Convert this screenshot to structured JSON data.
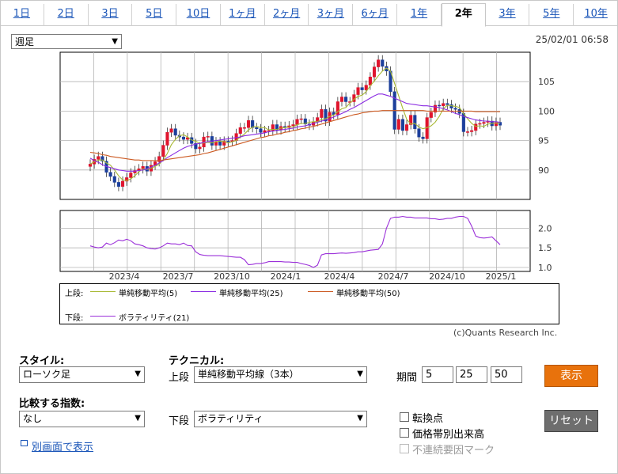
{
  "tabs": [
    "1日",
    "2日",
    "3日",
    "5日",
    "10日",
    "1ヶ月",
    "2ヶ月",
    "3ヶ月",
    "6ヶ月",
    "1年",
    "2年",
    "3年",
    "5年",
    "10年"
  ],
  "active_tab": "2年",
  "period_select": "週足",
  "timestamp": "25/02/01 06:58",
  "legend": {
    "upper_label": "上段:",
    "lower_label": "下段:",
    "items": [
      {
        "name": "単純移動平均(5)",
        "color": "#a8b833"
      },
      {
        "name": "単純移動平均(25)",
        "color": "#8a2be2"
      },
      {
        "name": "単純移動平均(50)",
        "color": "#cc5a22"
      }
    ],
    "lower_item": {
      "name": "ボラティリティ(21)",
      "color": "#9b30d9"
    }
  },
  "copyright": "(c)Quants Research Inc.",
  "controls": {
    "style_label": "スタイル:",
    "style_value": "ローソク足",
    "technical_label": "テクニカル:",
    "upper_label": "上段",
    "upper_value": "単純移動平均線（3本）",
    "period_label": "期間",
    "periods": [
      "5",
      "25",
      "50"
    ],
    "show_button": "表示",
    "compare_label": "比較する指数:",
    "compare_value": "なし",
    "lower_label": "下段",
    "lower_value": "ボラティリティ",
    "reset_button": "リセット",
    "checkboxes": [
      "転換点",
      "価格帯別出来高",
      "不連続要因マーク"
    ],
    "popup_link": "別画面で表示"
  },
  "chart_data": [
    {
      "type": "candlestick",
      "title": "",
      "y_ticks": [
        90,
        95,
        100,
        105
      ],
      "ylim": [
        85,
        110
      ],
      "x_ticks": [
        "2023/4",
        "2023/7",
        "2023/10",
        "2024/1",
        "2024/4",
        "2024/7",
        "2024/10",
        "2025/1"
      ],
      "close": [
        91.0,
        91.8,
        92.3,
        91.5,
        89.6,
        88.9,
        87.9,
        87.2,
        88.1,
        88.7,
        89.5,
        89.9,
        90.2,
        90.6,
        89.8,
        90.8,
        91.4,
        92.3,
        94.2,
        96.4,
        97.0,
        95.9,
        95.6,
        95.2,
        95.5,
        94.5,
        93.6,
        93.9,
        95.6,
        95.7,
        94.2,
        94.8,
        94.2,
        94.9,
        94.8,
        95.0,
        96.2,
        97.2,
        97.2,
        98.4,
        97.2,
        97.0,
        96.4,
        96.7,
        96.7,
        97.7,
        96.8,
        97.4,
        97.2,
        97.5,
        97.7,
        98.6,
        98.7,
        97.8,
        97.6,
        98.2,
        98.9,
        100.3,
        98.3,
        99.8,
        99.4,
        101.6,
        102.4,
        101.6,
        101.6,
        102.8,
        104.0,
        103.6,
        104.4,
        105.8,
        107.5,
        108.7,
        107.6,
        106.8,
        103.3,
        96.9,
        98.6,
        96.7,
        97.7,
        99.3,
        97.0,
        95.6,
        95.3,
        98.9,
        99.8,
        101.0,
        100.9,
        101.3,
        101.1,
        100.5,
        100.3,
        99.6,
        96.5,
        96.5,
        96.7,
        97.8,
        97.9,
        98.1,
        98.3,
        97.5,
        98.1,
        97.6
      ],
      "series": [
        {
          "name": "単純移動平均(5)",
          "values": [
            91.0,
            91.4,
            91.7,
            91.7,
            91.2,
            90.8,
            90.0,
            89.0,
            88.3,
            88.2,
            88.5,
            89.0,
            89.7,
            90.2,
            90.1,
            90.3,
            90.6,
            91.0,
            91.7,
            92.8,
            94.3,
            95.2,
            95.8,
            96.0,
            95.6,
            95.1,
            94.9,
            94.5,
            94.6,
            94.7,
            94.6,
            94.8,
            94.9,
            94.8,
            94.6,
            94.8,
            95.0,
            95.6,
            96.1,
            96.8,
            97.3,
            97.4,
            97.2,
            97.2,
            96.8,
            96.9,
            96.9,
            97.1,
            97.2,
            97.3,
            97.3,
            97.7,
            97.9,
            97.9,
            98.1,
            98.2,
            98.2,
            98.6,
            98.7,
            99.1,
            99.3,
            99.9,
            100.4,
            100.6,
            101.4,
            102.0,
            102.5,
            102.7,
            103.3,
            104.3,
            105.1,
            106.0,
            106.8,
            107.3,
            106.8,
            104.7,
            102.6,
            100.5,
            98.6,
            97.8,
            97.9,
            97.3,
            97.0,
            97.2,
            97.5,
            98.1,
            99.1,
            100.4,
            101.0,
            100.9,
            100.8,
            100.6,
            99.6,
            98.7,
            97.9,
            97.4,
            97.5,
            97.4,
            97.8,
            97.9,
            98.0,
            97.9
          ]
        },
        {
          "name": "単純移動平均(25)",
          "values": [
            92.0,
            91.6,
            91.3,
            90.9,
            90.6,
            90.4,
            90.2,
            90.0,
            89.9,
            89.8,
            89.8,
            89.8,
            89.9,
            90.0,
            90.2,
            90.5,
            90.8,
            91.2,
            91.6,
            92.1,
            92.5,
            92.9,
            93.3,
            93.7,
            94.0,
            94.2,
            94.4,
            94.5,
            94.7,
            94.8,
            94.9,
            95.0,
            95.1,
            95.2,
            95.3,
            95.4,
            95.5,
            95.6,
            95.8,
            95.9,
            96.0,
            96.1,
            96.2,
            96.3,
            96.5,
            96.6,
            96.7,
            96.8,
            96.9,
            97.0,
            97.1,
            97.3,
            97.4,
            97.5,
            97.7,
            97.9,
            98.1,
            98.3,
            98.5,
            98.7,
            99.0,
            99.3,
            99.6,
            99.9,
            100.3,
            100.6,
            101.0,
            101.4,
            101.8,
            102.2,
            102.6,
            102.9,
            102.9,
            102.7,
            102.5,
            102.2,
            101.9,
            101.6,
            101.3,
            101.2,
            101.1,
            101.0,
            100.9,
            100.9,
            100.8,
            100.7,
            100.6,
            100.4,
            100.2,
            99.9,
            99.6,
            99.4,
            99.1,
            98.9,
            98.7,
            98.5,
            98.4,
            98.3,
            98.3,
            98.2,
            98.2,
            98.1
          ]
        },
        {
          "name": "単純移動平均(50)",
          "values": [
            93.0,
            92.9,
            92.8,
            92.6,
            92.5,
            92.3,
            92.2,
            92.1,
            92.0,
            91.9,
            91.8,
            91.7,
            91.7,
            91.6,
            91.6,
            91.6,
            91.6,
            91.6,
            91.7,
            91.8,
            91.9,
            92.0,
            92.1,
            92.2,
            92.3,
            92.4,
            92.5,
            92.6,
            92.8,
            92.9,
            93.1,
            93.3,
            93.5,
            93.7,
            93.9,
            94.1,
            94.3,
            94.5,
            94.7,
            94.9,
            95.1,
            95.3,
            95.5,
            95.6,
            95.8,
            95.9,
            96.1,
            96.2,
            96.4,
            96.5,
            96.7,
            96.8,
            97.0,
            97.1,
            97.3,
            97.4,
            97.6,
            97.8,
            98.0,
            98.2,
            98.4,
            98.6,
            98.8,
            99.0,
            99.2,
            99.4,
            99.5,
            99.7,
            99.8,
            99.9,
            100.0,
            100.0,
            100.1,
            100.1,
            100.1,
            100.1,
            100.1,
            100.1,
            100.1,
            100.1,
            100.1,
            100.1,
            100.1,
            100.0,
            100.0,
            100.0,
            100.0,
            100.0,
            100.0,
            100.0,
            100.0,
            100.0,
            100.0,
            100.0,
            100.0,
            99.9,
            99.9,
            99.9,
            99.9,
            99.9,
            99.9,
            99.9
          ]
        }
      ]
    },
    {
      "type": "line",
      "title": "",
      "y_ticks": [
        1.0,
        1.5,
        2.0
      ],
      "ylim": [
        0.9,
        2.45
      ],
      "series": [
        {
          "name": "ボラティリティ(21)",
          "values": [
            1.55,
            1.52,
            1.5,
            1.52,
            1.62,
            1.58,
            1.63,
            1.7,
            1.68,
            1.72,
            1.68,
            1.6,
            1.58,
            1.55,
            1.5,
            1.48,
            1.47,
            1.5,
            1.55,
            1.62,
            1.6,
            1.6,
            1.58,
            1.62,
            1.56,
            1.55,
            1.4,
            1.33,
            1.31,
            1.3,
            1.3,
            1.3,
            1.3,
            1.29,
            1.28,
            1.27,
            1.26,
            1.26,
            1.2,
            1.07,
            1.08,
            1.1,
            1.1,
            1.12,
            1.15,
            1.15,
            1.15,
            1.15,
            1.14,
            1.14,
            1.13,
            1.13,
            1.1,
            1.08,
            1.05,
            1.0,
            1.06,
            1.32,
            1.35,
            1.35,
            1.35,
            1.36,
            1.37,
            1.36,
            1.37,
            1.38,
            1.4,
            1.4,
            1.42,
            1.44,
            1.45,
            1.46,
            1.6,
            2.0,
            2.25,
            2.28,
            2.28,
            2.3,
            2.28,
            2.28,
            2.26,
            2.26,
            2.26,
            2.26,
            2.24,
            2.24,
            2.22,
            2.23,
            2.25,
            2.25,
            2.28,
            2.3,
            2.3,
            2.25,
            2.05,
            1.8,
            1.76,
            1.75,
            1.76,
            1.78,
            1.68,
            1.58
          ]
        }
      ]
    }
  ]
}
